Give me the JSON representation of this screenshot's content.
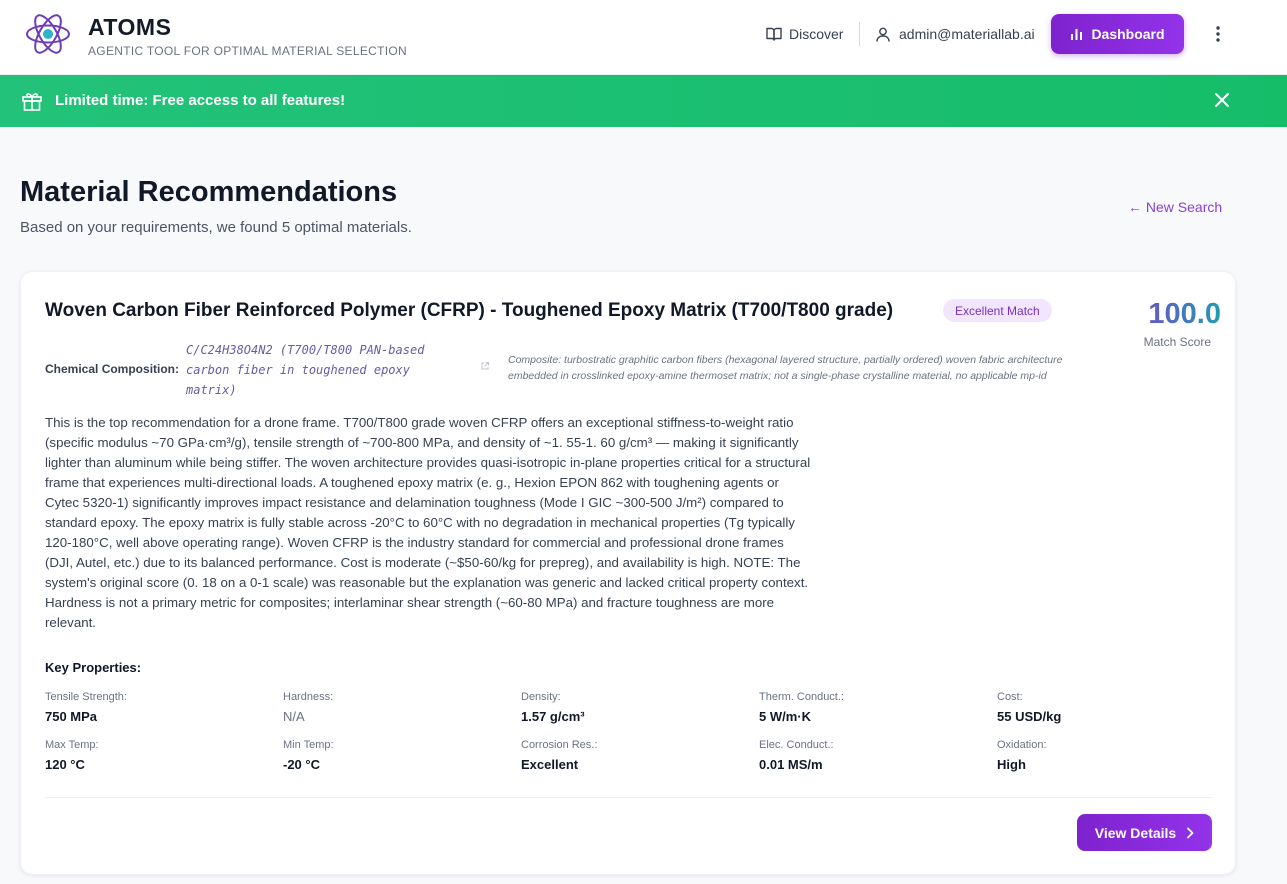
{
  "header": {
    "brand_title": "ATOMS",
    "brand_subtitle": "AGENTIC TOOL FOR OPTIMAL MATERIAL SELECTION",
    "nav_discover": "Discover",
    "user_email": "admin@materiallab.ai",
    "dashboard_label": "Dashboard"
  },
  "banner": {
    "text": "Limited time: Free access to all features!"
  },
  "page": {
    "title": "Material Recommendations",
    "subtitle": "Based on your requirements, we found 5 optimal materials.",
    "new_search": "← New Search"
  },
  "material": {
    "name": "Woven Carbon Fiber Reinforced Polymer (CFRP) - Toughened Epoxy Matrix (T700/T800 grade)",
    "badge": "Excellent Match",
    "score": "100.0",
    "score_label": "Match Score",
    "composition_label": "Chemical Composition:",
    "composition_formula": "C/C24H38O4N2 (T700/T800 PAN-based carbon fiber in toughened epoxy matrix)",
    "composition_desc": "Composite: turbostratic graphitic carbon fibers (hexagonal layered structure, partially ordered) woven fabric architecture embedded in crosslinked epoxy-amine thermoset matrix; not a single-phase crystalline material, no applicable mp-id",
    "description": "This is the top recommendation for a drone frame. T700/T800 grade woven CFRP offers an exceptional stiffness-to-weight ratio (specific modulus ~70 GPa·cm³/g), tensile strength of ~700-800 MPa, and density of ~1. 55-1. 60 g/cm³ — making it significantly lighter than aluminum while being stiffer. The woven architecture provides quasi-isotropic in-plane properties critical for a structural frame that experiences multi-directional loads. A toughened epoxy matrix (e. g., Hexion EPON 862 with toughening agents or Cytec 5320-1) significantly improves impact resistance and delamination toughness (Mode I GIC ~300-500 J/m²) compared to standard epoxy. The epoxy matrix is fully stable across -20°C to 60°C with no degradation in mechanical properties (Tg typically 120-180°C, well above operating range). Woven CFRP is the industry standard for commercial and professional drone frames (DJI, Autel, etc.) due to its balanced performance. Cost is moderate (~$50-60/kg for prepreg), and availability is high. NOTE: The system's original score (0. 18 on a 0-1 scale) was reasonable but the explanation was generic and lacked critical property context. Hardness is not a primary metric for composites; interlaminar shear strength (~60-80 MPa) and fracture toughness are more relevant.",
    "key_properties_title": "Key Properties:",
    "properties": [
      {
        "label": "Tensile Strength:",
        "value": "750 MPa"
      },
      {
        "label": "Hardness:",
        "value": "N/A"
      },
      {
        "label": "Density:",
        "value": "1.57 g/cm³"
      },
      {
        "label": "Therm. Conduct.:",
        "value": "5 W/m·K"
      },
      {
        "label": "Cost:",
        "value": "55 USD/kg"
      },
      {
        "label": "Max Temp:",
        "value": "120 °C"
      },
      {
        "label": "Min Temp:",
        "value": "-20 °C"
      },
      {
        "label": "Corrosion Res.:",
        "value": "Excellent"
      },
      {
        "label": "Elec. Conduct.:",
        "value": "0.01 MS/m"
      },
      {
        "label": "Oxidation:",
        "value": "High"
      }
    ],
    "view_details": "View Details"
  },
  "colors": {
    "accent": "#8b2fe0",
    "banner": "#1dbf72",
    "badge_bg": "#f1e6fd"
  },
  "icons": {
    "logo": "atom-icon",
    "discover": "book-icon",
    "user": "user-icon",
    "dashboard": "bar-chart-icon",
    "menu": "more-vertical-icon",
    "banner": "gift-icon",
    "close": "close-icon",
    "link": "external-link-icon",
    "details": "chevron-right-icon"
  }
}
